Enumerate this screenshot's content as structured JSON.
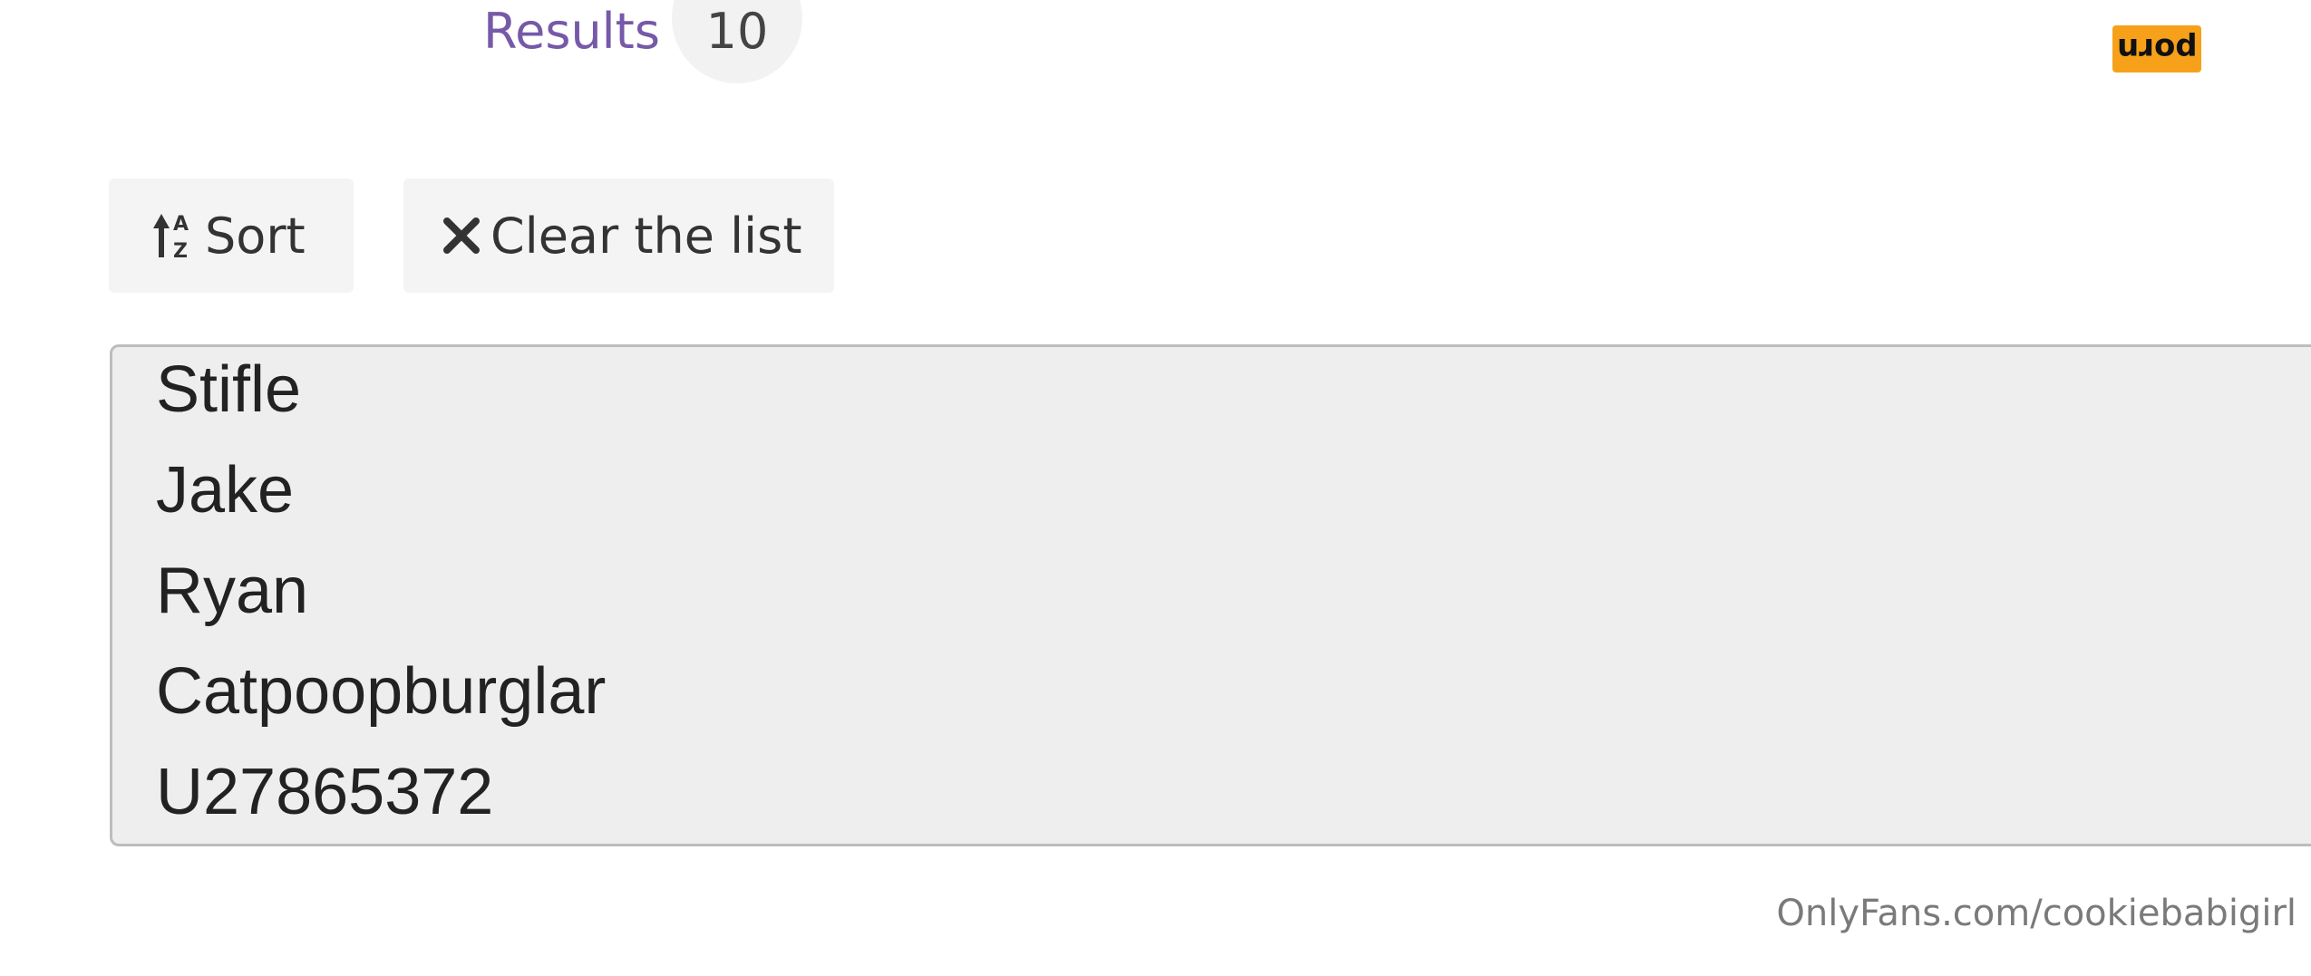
{
  "results": {
    "label": "Results",
    "count": "10"
  },
  "badge": {
    "text": "porn",
    "color": "#f7a11a"
  },
  "toolbar": {
    "sort_label": "Sort",
    "clear_label": "Clear the list"
  },
  "list": {
    "items": [
      "Stifle",
      "Jake",
      "Ryan",
      "Catpoopburglar",
      "U27865372"
    ]
  },
  "watermark": "OnlyFans.com/cookiebabigirl",
  "icons": {
    "sort": "sort-alpha-icon",
    "clear": "close-icon"
  },
  "colors": {
    "results_label": "#7659a8",
    "button_bg": "#f4f4f4",
    "list_bg": "#eeeeee"
  }
}
